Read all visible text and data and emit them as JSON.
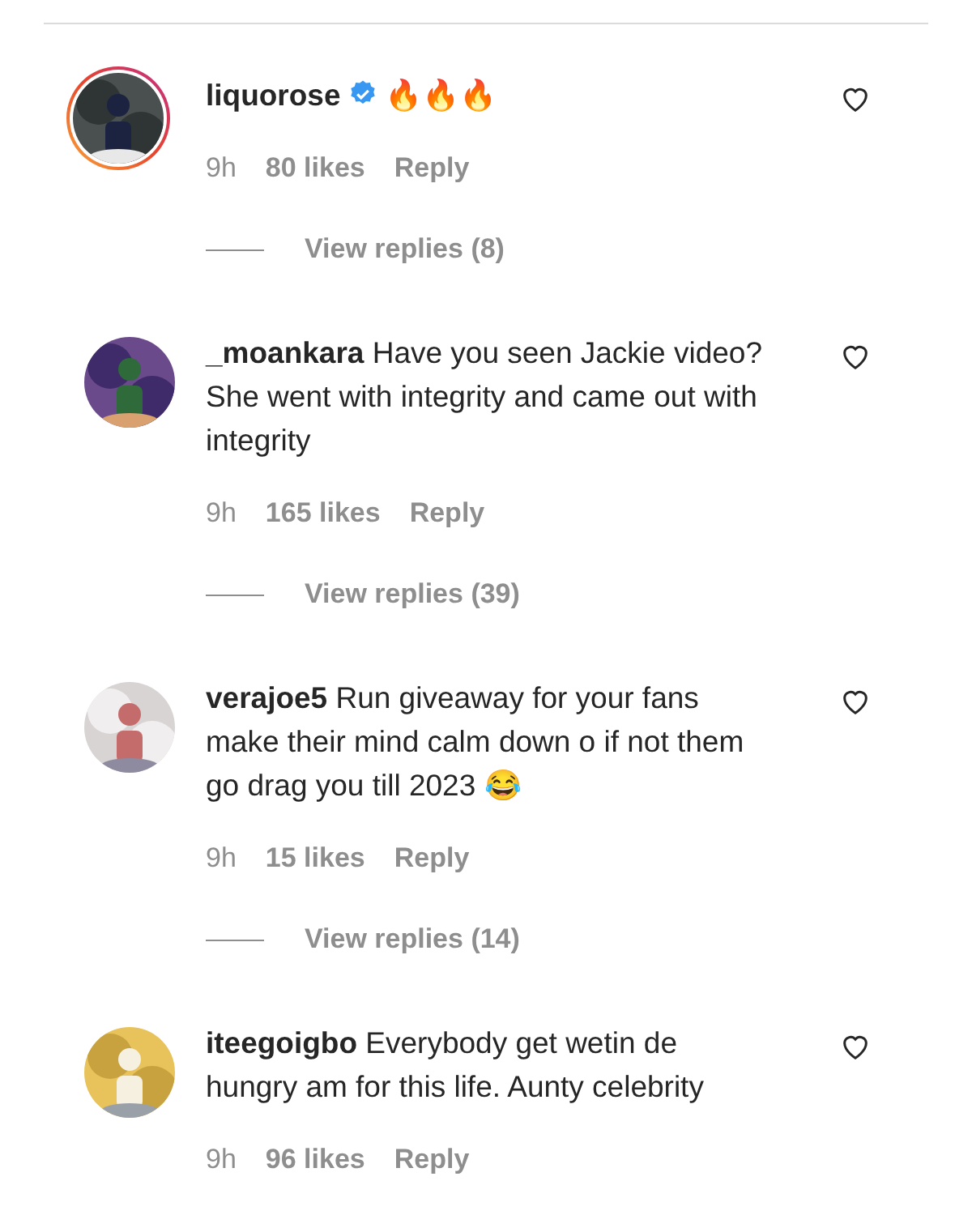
{
  "comments": [
    {
      "username": "liquorose",
      "verified": true,
      "has_story": true,
      "text": "🔥🔥🔥",
      "time": "9h",
      "likes": "80 likes",
      "reply": "Reply",
      "liked": false,
      "view_replies": "View replies (8)"
    },
    {
      "username": "_moankara",
      "verified": false,
      "has_story": false,
      "text": "Have you seen Jackie video? She went with integrity and came out with integrity",
      "time": "9h",
      "likes": "165 likes",
      "reply": "Reply",
      "liked": false,
      "view_replies": "View replies (39)"
    },
    {
      "username": "verajoe5",
      "verified": false,
      "has_story": false,
      "text": "Run giveaway for your fans make their mind calm down o if not them go drag you till 2023 😂",
      "time": "9h",
      "likes": "15 likes",
      "reply": "Reply",
      "liked": false,
      "view_replies": "View replies (14)"
    },
    {
      "username": "iteegoigbo",
      "verified": false,
      "has_story": false,
      "text": "Everybody get wetin de hungry am for this life. Aunty celebrity",
      "time": "9h",
      "likes": "96 likes",
      "reply": "Reply",
      "liked": false
    }
  ]
}
